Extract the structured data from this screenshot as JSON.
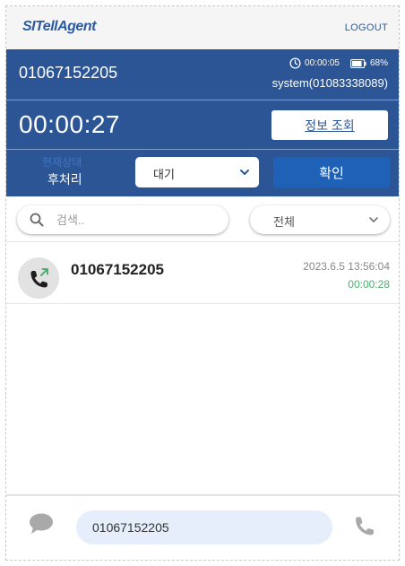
{
  "header": {
    "logo": "SITellAgent",
    "logout_label": "LOGOUT"
  },
  "call": {
    "caller_number": "01067152205",
    "elapsed_small": "00:00:05",
    "battery": "68%",
    "system_user": "system(01083338089)",
    "timer": "00:00:27",
    "info_button_label": "정보 조회"
  },
  "state": {
    "label": "현재상태",
    "value": "후처리",
    "select_value": "대기",
    "confirm_label": "확인"
  },
  "filters": {
    "search_placeholder": "검색..",
    "filter_value": "전체"
  },
  "calls": [
    {
      "number": "01067152205",
      "datetime": "2023.6.5 13:56:04",
      "duration": "00:00:28",
      "direction_icon": "outgoing-call-icon"
    }
  ],
  "dialer": {
    "value": "01067152205"
  },
  "colors": {
    "primary_blue": "#2c5596",
    "button_blue": "#1f61b6",
    "duration_green": "#4caf6f",
    "state_label_blue": "#3f75c2"
  }
}
